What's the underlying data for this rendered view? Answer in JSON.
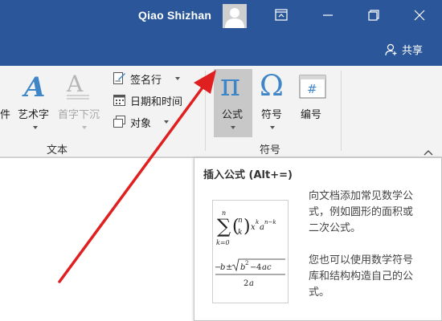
{
  "titlebar": {
    "user_name": "Qiao Shizhan",
    "share_label": "共享",
    "bg_color": "#2b579a"
  },
  "ribbon": {
    "text_group": {
      "label": "文本",
      "items": {
        "partial_item": "件",
        "wordart": "艺术字",
        "dropcap": "首字下沉",
        "signature_line": "签名行",
        "datetime": "日期和时间",
        "object": "对象"
      }
    },
    "symbols_group": {
      "label": "符号",
      "items": {
        "equation": "公式",
        "symbol": "符号",
        "number": "编号"
      }
    }
  },
  "tooltip": {
    "title": "插入公式 (Alt+=)",
    "desc1": [
      "向文档添加常见数学公",
      "式，例如圆形的面积或",
      "二次公式。"
    ],
    "desc2": [
      "您也可以使用数学符号",
      "库和结构构造自己的公",
      "式。"
    ]
  },
  "icons": [
    "user-avatar-icon",
    "ribbon-display-icon",
    "minimize-icon",
    "restore-icon",
    "close-icon",
    "share-person-icon",
    "wordart-icon",
    "dropcap-icon",
    "signature-line-icon",
    "datetime-icon",
    "object-icon",
    "pi-icon",
    "omega-icon",
    "number-icon",
    "collapse-ribbon-icon"
  ]
}
